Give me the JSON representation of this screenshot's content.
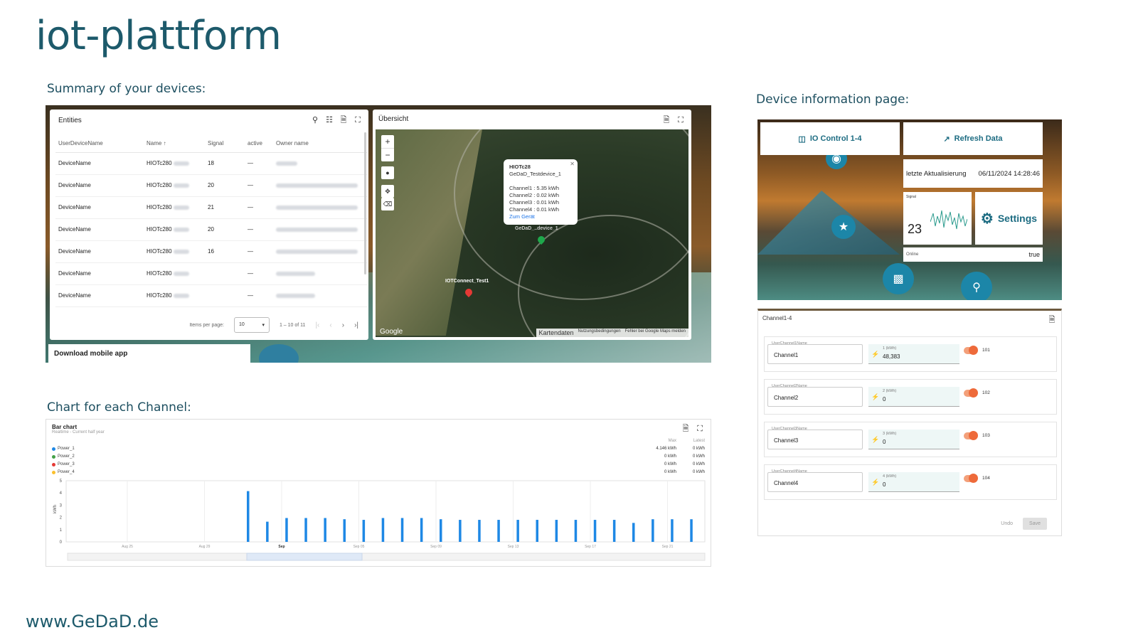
{
  "title": "iot-plattform",
  "captions": {
    "summary": "Summary of your devices:",
    "chart": "Chart for each Channel:",
    "device_info": "Device information page:"
  },
  "footer": "www.GeDaD.de",
  "entities": {
    "title": "Entities",
    "columns": [
      "UserDeviceName",
      "Name ↑",
      "Signal",
      "active",
      "Owner name"
    ],
    "rows": [
      {
        "user": "DeviceName",
        "name": "HIOTc280",
        "signal": "18",
        "active": "—"
      },
      {
        "user": "DeviceName",
        "name": "HIOTc280",
        "signal": "20",
        "active": "—"
      },
      {
        "user": "DeviceName",
        "name": "HIOTc280",
        "signal": "21",
        "active": "—"
      },
      {
        "user": "DeviceName",
        "name": "HIOTc280",
        "signal": "20",
        "active": "—"
      },
      {
        "user": "DeviceName",
        "name": "HIOTc280",
        "signal": "16",
        "active": "—"
      },
      {
        "user": "DeviceName",
        "name": "HIOTc280",
        "signal": "",
        "active": "—"
      },
      {
        "user": "DeviceName",
        "name": "HIOTc280",
        "signal": "",
        "active": "—"
      }
    ],
    "items_per_page_label": "Items per page:",
    "items_per_page": "10",
    "range": "1 – 10 of 11"
  },
  "map": {
    "title": "Übersicht",
    "popup": {
      "device": "HIOTc28",
      "name": "GeDaD_Testdevice_1",
      "channels": [
        "Channel1 : 5.35 kWh",
        "Channel2 : 0.02 kWh",
        "Channel3 : 0.01 kWh",
        "Channel4 : 0.01 kWh"
      ],
      "link": "Zum Gerät"
    },
    "marker_green_label": "GeDaD_..device_1",
    "marker_red_label": "IOTConnect_Test1",
    "google": "Google",
    "footer": [
      "Kartendaten",
      "Nutzungsbedingungen",
      "Fehler bei Google Maps melden"
    ]
  },
  "mobile_app": "Download mobile app",
  "chart_card": {
    "title": "Bar chart",
    "subtitle": "Realtime - Current half year",
    "legend": [
      {
        "name": "Power_1",
        "color": "#1e88e5",
        "max": "4.146 kWh",
        "latest": "0 kWh"
      },
      {
        "name": "Power_2",
        "color": "#43a047",
        "max": "0 kWh",
        "latest": "0 kWh"
      },
      {
        "name": "Power_3",
        "color": "#e53935",
        "max": "0 kWh",
        "latest": "0 kWh"
      },
      {
        "name": "Power_4",
        "color": "#fbc02d",
        "max": "0 kWh",
        "latest": "0 kWh"
      }
    ],
    "stat_headers": [
      "Max",
      "Latest"
    ]
  },
  "chart_data": {
    "type": "bar",
    "title": "Bar chart",
    "ylabel": "kWh",
    "ylim": [
      0,
      5
    ],
    "yticks": [
      0,
      1,
      2,
      3,
      4,
      5
    ],
    "xticks": [
      "Aug 25",
      "Aug 29",
      "Sep",
      "Sep 05",
      "Sep 09",
      "Sep 13",
      "Sep 17",
      "Sep 21"
    ],
    "series": [
      {
        "name": "Power_1",
        "color": "#1e88e5",
        "values": [
          4.15,
          1.65,
          1.95,
          1.95,
          1.95,
          1.85,
          1.8,
          1.95,
          1.95,
          1.95,
          1.85,
          1.8,
          1.8,
          1.8,
          1.8,
          1.8,
          1.8,
          1.8,
          1.8,
          1.8,
          1.55,
          1.85,
          1.85,
          1.85
        ]
      }
    ]
  },
  "device": {
    "io_control": "IO Control 1-4",
    "refresh": "Refresh Data",
    "updated_label": "letzte Aktualisierung",
    "updated_value": "06/11/2024 14:28:46",
    "signal_title": "Signal",
    "signal_value": "23",
    "settings": "Settings",
    "online_label": "Online",
    "online_value": "true"
  },
  "channels": {
    "title": "Channel1-4",
    "rows": [
      {
        "label": "UserChannel1Name",
        "name": "Channel1",
        "unit": "1 (kWh)",
        "value": "48,383",
        "toggle": "101"
      },
      {
        "label": "UserChannel2Name",
        "name": "Channel2",
        "unit": "2 (kWh)",
        "value": "0",
        "toggle": "102"
      },
      {
        "label": "UserChannel3Name",
        "name": "Channel3",
        "unit": "3 (kWh)",
        "value": "0",
        "toggle": "103"
      },
      {
        "label": "UserChannel4Name",
        "name": "Channel4",
        "unit": "4 (kWh)",
        "value": "0",
        "toggle": "104"
      }
    ],
    "undo": "Undo",
    "save": "Save"
  }
}
